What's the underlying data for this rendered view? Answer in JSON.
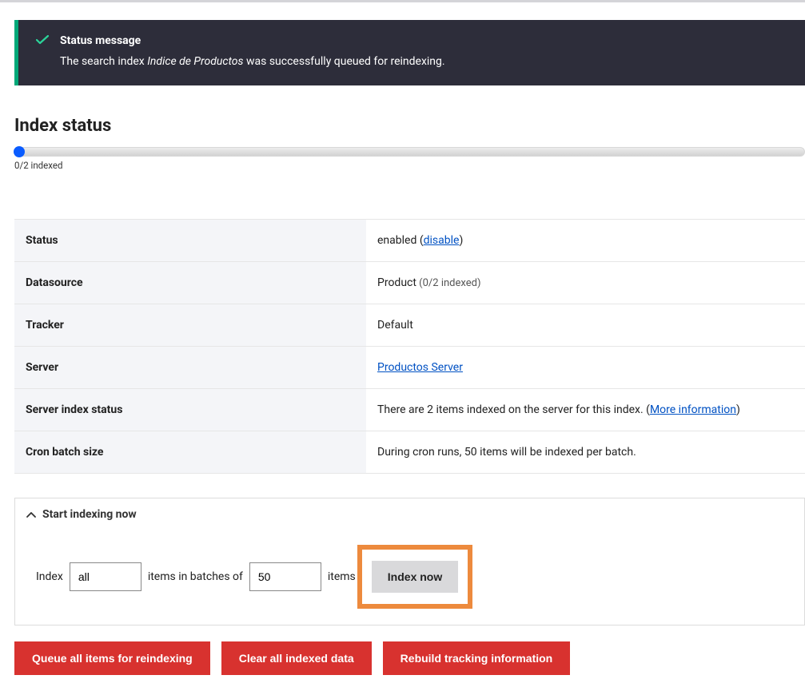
{
  "status_message": {
    "title": "Status message",
    "prefix": "The search index ",
    "index_name": "Indice de Productos",
    "suffix": " was successfully queued for reindexing."
  },
  "section_title": "Index status",
  "progress": {
    "label": "0/2 indexed"
  },
  "details": {
    "rows": {
      "status": {
        "label": "Status",
        "value": "enabled",
        "paren_open": " (",
        "disable_link": "disable",
        "paren_close": ")"
      },
      "datasource": {
        "label": "Datasource",
        "value": "Product",
        "muted": " (0/2 indexed)"
      },
      "tracker": {
        "label": "Tracker",
        "value": "Default"
      },
      "server": {
        "label": "Server",
        "link": "Productos Server"
      },
      "server_index_status": {
        "label": "Server index status",
        "prefix": "There are 2 items indexed on the server for this index. (",
        "more_link": "More information",
        "suffix": ")"
      },
      "cron": {
        "label": "Cron batch size",
        "value": "During cron runs, 50 items will be indexed per batch."
      }
    }
  },
  "fieldset": {
    "legend": "Start indexing now",
    "label_index": "Index",
    "input_all_value": "all",
    "label_batches": "items in batches of",
    "input_batch_value": "50",
    "label_items": "items",
    "button_index_now": "Index now"
  },
  "actions": {
    "queue": "Queue all items for reindexing",
    "clear": "Clear all indexed data",
    "rebuild": "Rebuild tracking information"
  }
}
